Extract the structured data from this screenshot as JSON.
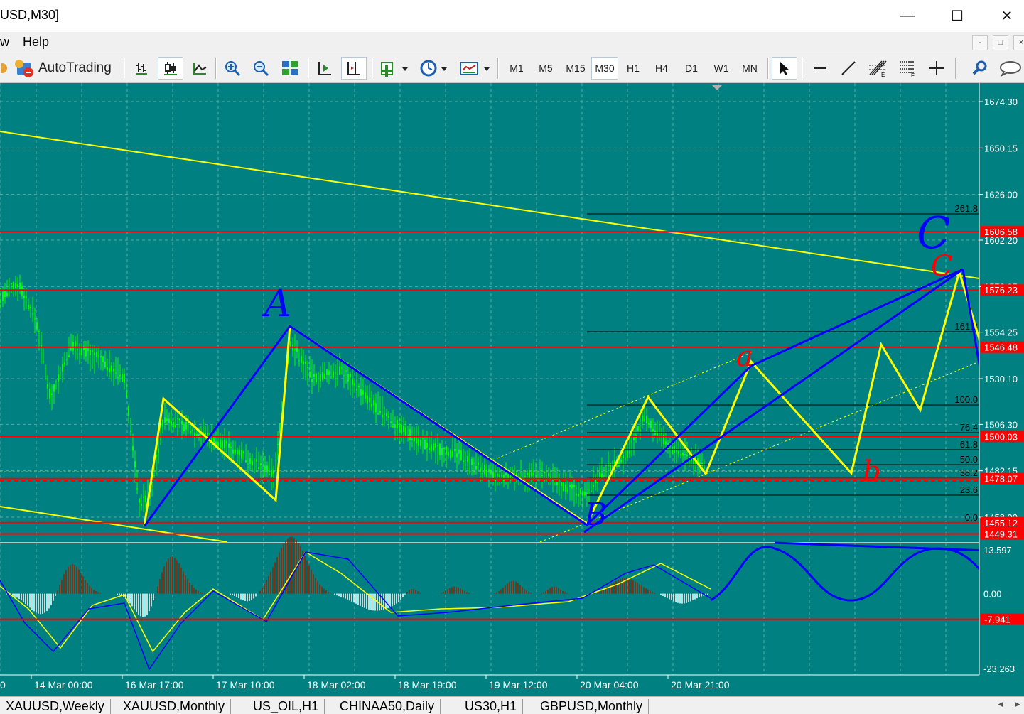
{
  "window": {
    "title": "USD,M30]",
    "minimize_glyph": "—",
    "maximize_glyph": "☐",
    "close_glyph": "✕"
  },
  "menu": {
    "items": [
      "w",
      "Help"
    ],
    "mdi_buttons": [
      "-",
      "□",
      "×"
    ]
  },
  "toolbar": {
    "autotrading_label": "AutoTrading",
    "timeframes": [
      "M1",
      "M5",
      "M15",
      "M30",
      "H1",
      "H4",
      "D1",
      "W1",
      "MN"
    ],
    "selected_timeframe": "M30",
    "icons": [
      "bar-chart-icon",
      "candlestick-icon",
      "line-chart-icon",
      "zoom-in-icon",
      "zoom-out-icon",
      "tile-windows-icon",
      "autoscroll-icon",
      "chart-shift-icon",
      "add-indicator-icon",
      "periods-icon",
      "templates-icon",
      "cursor-icon",
      "horizontal-line-icon",
      "trend-line-icon",
      "fibonacci-icon",
      "fibo-channel-icon",
      "crosshair-icon",
      "search-icon",
      "chat-icon"
    ]
  },
  "chart_data": {
    "type": "candlestick",
    "symbol": "USD",
    "timeframe": "M30",
    "price_ticks": [
      "1674.30",
      "1650.15",
      "1626.00",
      "1602.20",
      "1578.05",
      "1554.25",
      "1530.10",
      "1506.30",
      "1482.15",
      "1458.00"
    ],
    "price_range": [
      1448,
      1682
    ],
    "indicator_ticks": [
      "13.597",
      "0.00",
      "-23.263"
    ],
    "indicator_range": [
      -23.263,
      13.597
    ],
    "date_ticks": [
      "14 Mar 00:00",
      "16 Mar 17:00",
      "17 Mar 10:00",
      "18 Mar 02:00",
      "18 Mar 19:00",
      "19 Mar 12:00",
      "20 Mar 04:00",
      "20 Mar 21:00"
    ],
    "leading_tick": "0",
    "horizontal_levels": [
      {
        "label": "1606.58",
        "price": 1606.58,
        "color": "#ff0000"
      },
      {
        "label": "1576.23",
        "price": 1576.23,
        "color": "#ff0000"
      },
      {
        "label": "1546.48",
        "price": 1546.48,
        "color": "#ff0000"
      },
      {
        "label": "1500.03",
        "price": 1500.03,
        "color": "#ff0000"
      },
      {
        "label": "1478.07",
        "price": 1478.07,
        "color": "#ff0000"
      },
      {
        "label": "1455.12",
        "price": 1455.12,
        "color": "#ff0000"
      },
      {
        "label": "1449.31",
        "price": 1449.31,
        "color": "#ff0000"
      }
    ],
    "indicator_level": {
      "label": "-7.941",
      "value": -7.941
    },
    "fibonacci_levels": [
      "261.8",
      "161.8",
      "100.0",
      "76.4",
      "61.8",
      "50.0",
      "38.2",
      "23.6",
      "0.0"
    ],
    "annotations": [
      {
        "text": "A",
        "color": "#0000ff"
      },
      {
        "text": "B",
        "color": "#0000ff"
      },
      {
        "text": "C",
        "color": "#0000ff"
      },
      {
        "text": "C",
        "color": "#ff0000"
      },
      {
        "text": "a",
        "color": "#ff0000"
      },
      {
        "text": "b",
        "color": "#ff0000"
      }
    ],
    "colors": {
      "background": "#008080",
      "bars": "#00ff00",
      "zigzag": "#ffff00",
      "wave_lines": "#0000ff",
      "levels": "#ff0000",
      "fibo": "#000000",
      "macd_histogram_up": "#8b2500",
      "macd_histogram_down": "#ffffff",
      "macd_signal": "#ffff00",
      "macd_main": "#0000ff"
    }
  },
  "tabs": {
    "items": [
      "XAUUSD,Weekly",
      "XAUUSD,Monthly",
      "US_OIL,H1",
      "CHINAA50,Daily",
      "US30,H1",
      "GBPUSD,Monthly"
    ],
    "left_arrow": "◄",
    "right_arrow": "►"
  }
}
